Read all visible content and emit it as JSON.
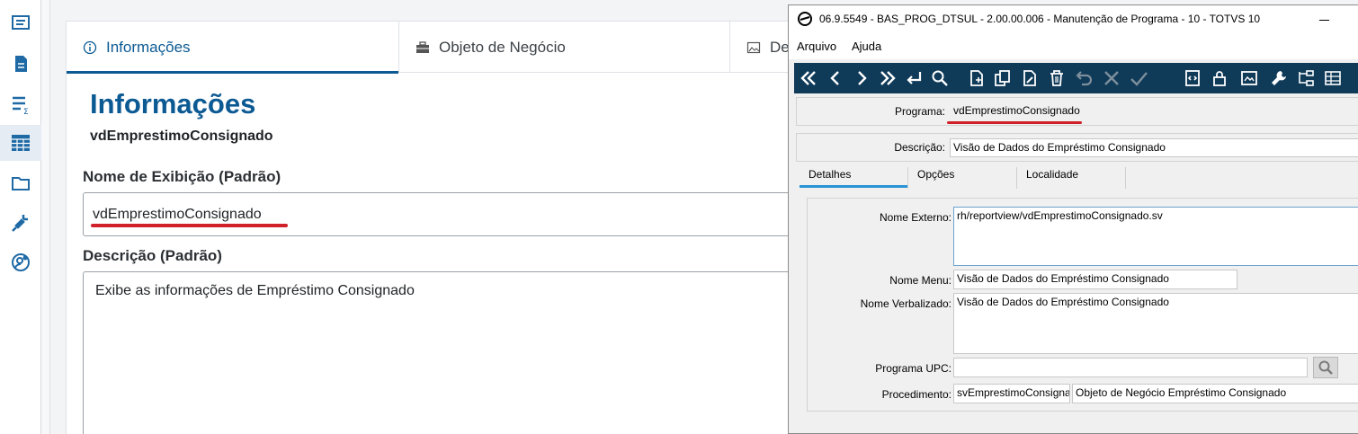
{
  "sidebar": {
    "items": [
      {
        "icon": "message-icon"
      },
      {
        "icon": "document-icon"
      },
      {
        "icon": "list-sum-icon"
      },
      {
        "icon": "table-grid-icon",
        "active": true
      },
      {
        "icon": "folder-icon"
      },
      {
        "icon": "plug-icon"
      },
      {
        "icon": "user-settings-icon"
      }
    ]
  },
  "web": {
    "tabs": [
      {
        "label": "Informações",
        "icon": "info-icon"
      },
      {
        "label": "Objeto de Negócio",
        "icon": "briefcase-icon"
      },
      {
        "label": "De",
        "icon": "image-icon"
      }
    ],
    "heading": "Informações",
    "subheading": "vdEmprestimoConsignado",
    "display_name_label": "Nome de Exibição (Padrão)",
    "display_name_value": "vdEmprestimoConsignado",
    "description_label": "Descrição (Padrão)",
    "description_value": "Exibe as informações de Empréstimo Consignado"
  },
  "totvs": {
    "title": "06.9.5549 - BAS_PROG_DTSUL - 2.00.00.006 - Manutenção de Programa - 10 - TOTVS 10",
    "menu": [
      "Arquivo",
      "Ajuda"
    ],
    "toolbar_icons": [
      "first-icon",
      "previous-icon",
      "next-icon",
      "last-icon",
      "goto-icon",
      "search-icon",
      "new-icon",
      "copy-icon",
      "edit-icon",
      "delete-icon",
      "undo-icon",
      "cancel-icon",
      "confirm-icon",
      "code-icon",
      "lock-icon",
      "print-icon",
      "wrench-icon",
      "tree-icon",
      "grid-icon"
    ],
    "programa_label": "Programa:",
    "programa_value": "vdEmprestimoConsignado",
    "descricao_label": "Descrição:",
    "descricao_value": "Visão de Dados do Empréstimo Consignado",
    "tabs": [
      "Detalhes",
      "Opções",
      "Localidade"
    ],
    "nome_externo_label": "Nome Externo:",
    "nome_externo_value": "rh/reportview/vdEmprestimoConsignado.sv",
    "nome_menu_label": "Nome Menu:",
    "nome_menu_value": "Visão de Dados do Empréstimo Consignado",
    "nome_verbalizado_label": "Nome Verbalizado:",
    "nome_verbalizado_value": "Visão de Dados do Empréstimo Consignado",
    "programa_upc_label": "Programa UPC:",
    "programa_upc_value": "",
    "procedimento_label": "Procedimento:",
    "procedimento_value": "svEmprestimoConsignac",
    "procedimento_desc": "Objeto de Negócio Empréstimo Consignado"
  },
  "colors": {
    "brand": "#0c5a93",
    "toolbar": "#0f3a58",
    "highlight": "#d0202a"
  }
}
